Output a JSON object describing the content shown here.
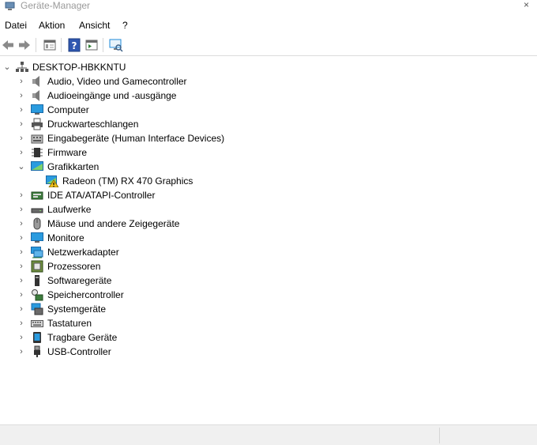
{
  "window": {
    "title": "Geräte-Manager",
    "close_glyph": "×"
  },
  "menu": [
    "Datei",
    "Aktion",
    "Ansicht",
    "?"
  ],
  "toolbar": {
    "buttons": [
      "back-arrow-icon",
      "forward-arrow-icon",
      "properties-icon",
      "help-icon",
      "console-tree-icon",
      "monitor-scan-icon"
    ]
  },
  "tree": {
    "root": {
      "label": "DESKTOP-HBKKNTU",
      "icon": "computer-tree-icon",
      "expanded": true
    },
    "categories": [
      {
        "label": "Audio, Video und Gamecontroller",
        "icon": "speaker-icon",
        "expanded": false
      },
      {
        "label": "Audioeingänge und -ausgänge",
        "icon": "speaker-icon",
        "expanded": false
      },
      {
        "label": "Computer",
        "icon": "monitor-icon",
        "expanded": false
      },
      {
        "label": "Druckwarteschlangen",
        "icon": "printer-icon",
        "expanded": false
      },
      {
        "label": "Eingabegeräte (Human Interface Devices)",
        "icon": "hid-icon",
        "expanded": false
      },
      {
        "label": "Firmware",
        "icon": "chip-icon",
        "expanded": false
      },
      {
        "label": "Grafikkarten",
        "icon": "display-adapter-icon",
        "expanded": true,
        "children": [
          {
            "label": "Radeon (TM) RX 470 Graphics",
            "icon": "display-adapter-warning-icon",
            "status": "warning"
          }
        ]
      },
      {
        "label": "IDE ATA/ATAPI-Controller",
        "icon": "ide-controller-icon",
        "expanded": false
      },
      {
        "label": "Laufwerke",
        "icon": "disk-drive-icon",
        "expanded": false
      },
      {
        "label": "Mäuse und andere Zeigegeräte",
        "icon": "mouse-icon",
        "expanded": false
      },
      {
        "label": "Monitore",
        "icon": "monitor-icon",
        "expanded": false
      },
      {
        "label": "Netzwerkadapter",
        "icon": "network-adapter-icon",
        "expanded": false
      },
      {
        "label": "Prozessoren",
        "icon": "processor-icon",
        "expanded": false
      },
      {
        "label": "Softwaregeräte",
        "icon": "software-device-icon",
        "expanded": false
      },
      {
        "label": "Speichercontroller",
        "icon": "storage-controller-icon",
        "expanded": false
      },
      {
        "label": "Systemgeräte",
        "icon": "system-device-icon",
        "expanded": false
      },
      {
        "label": "Tastaturen",
        "icon": "keyboard-icon",
        "expanded": false
      },
      {
        "label": "Tragbare Geräte",
        "icon": "portable-device-icon",
        "expanded": false
      },
      {
        "label": "USB-Controller",
        "icon": "usb-icon",
        "expanded": false
      }
    ]
  },
  "colors": {
    "accent": "#1e88d8",
    "warning": "#f2c31c"
  }
}
